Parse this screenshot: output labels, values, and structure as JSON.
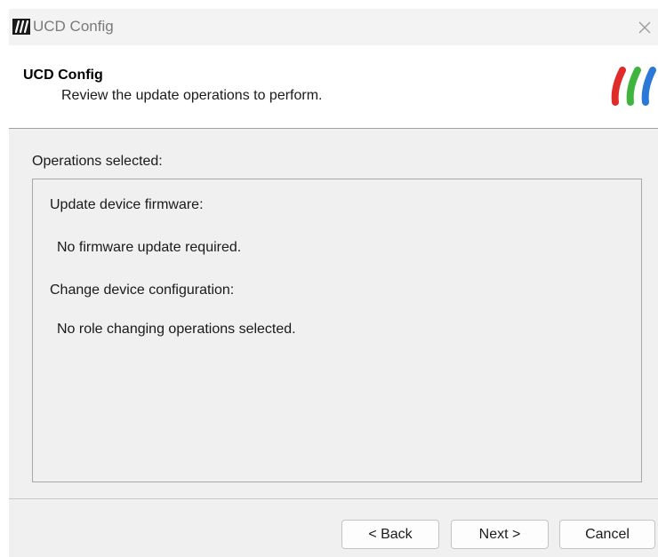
{
  "window": {
    "title": "UCD Config",
    "close_glyph": "×",
    "app_icon": "ucd-logo-icon"
  },
  "header": {
    "title": "UCD Config",
    "subtitle": "Review the update operations to perform.",
    "logo": "ucd-brand-logo",
    "logo_colors": [
      "#e02b2b",
      "#3fb53f",
      "#2b78d8"
    ]
  },
  "main": {
    "operations_label": "Operations selected:",
    "lines": [
      "Update device firmware:",
      "No firmware update required.",
      "Change device configuration:",
      "No role changing operations selected."
    ]
  },
  "footer": {
    "back_label": "< Back",
    "next_label": "Next >",
    "cancel_label": "Cancel"
  }
}
